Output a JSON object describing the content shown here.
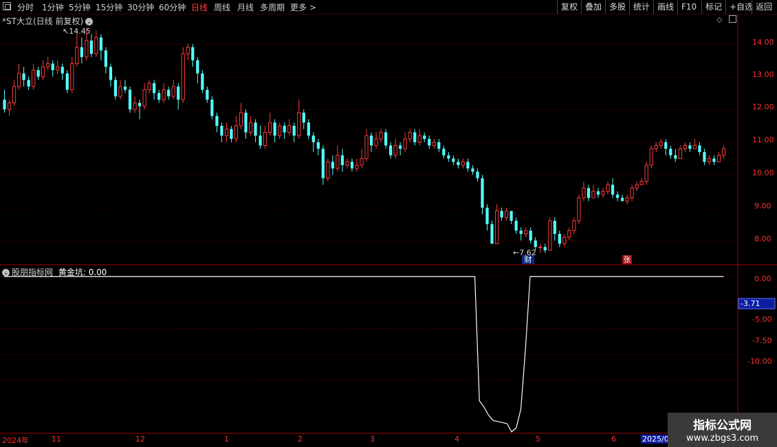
{
  "toolbar": {
    "periods": [
      "分时",
      "1分钟",
      "5分钟",
      "15分钟",
      "30分钟",
      "60分钟",
      "日线",
      "周线",
      "月线",
      "多周期",
      "更多"
    ],
    "active_period": "日线",
    "more_arrow": ">",
    "buttons": [
      "复权",
      "叠加",
      "多股",
      "统计",
      "画线",
      "F10",
      "标记",
      "+自选",
      "返回"
    ]
  },
  "main_chart": {
    "title": "*ST大立(日线 前复权)",
    "high_label": "14.45",
    "low_label": "7.62",
    "badge_cai": "财",
    "badge_zhang": "张",
    "price_axis": [
      "14.00",
      "13.00",
      "12.00",
      "11.00",
      "10.00",
      "9.00",
      "8.00"
    ]
  },
  "indicator": {
    "name": "股朋指标网",
    "series_name": "黄金坑:",
    "series_value": "0.00",
    "axis": [
      "0.00",
      "-2.50",
      "-5.00",
      "-7.50",
      "-10.00"
    ],
    "current_value": "-3.71"
  },
  "date_axis": [
    "2024年",
    "11",
    "12",
    "1",
    "2",
    "3",
    "4",
    "5",
    "6",
    "2025/0"
  ],
  "watermark": {
    "line1": "指标公式网",
    "line2": "www.zbgs3.com"
  },
  "colors": {
    "up": "#ff3c3c",
    "down": "#54ffff",
    "grid": "#7a0000",
    "axis": "#ff3030",
    "line": "#ffffff"
  },
  "chart_data": {
    "type": "candlestick",
    "price_ylim": [
      7.3,
      14.9
    ],
    "indicator_ylim": [
      -15,
      1
    ],
    "candles": [
      [
        12.3,
        12.0,
        12.6,
        11.9
      ],
      [
        12.0,
        12.2,
        12.3,
        11.8
      ],
      [
        12.2,
        12.7,
        12.9,
        12.1
      ],
      [
        12.7,
        13.1,
        13.4,
        12.6
      ],
      [
        13.1,
        12.9,
        13.3,
        12.7
      ],
      [
        12.9,
        12.7,
        13.0,
        12.6
      ],
      [
        12.7,
        13.2,
        13.4,
        12.6
      ],
      [
        13.2,
        13.0,
        13.3,
        12.9
      ],
      [
        13.0,
        13.3,
        13.5,
        12.9
      ],
      [
        13.3,
        13.4,
        13.6,
        13.2
      ],
      [
        13.4,
        13.2,
        13.5,
        13.0
      ],
      [
        13.2,
        13.3,
        13.5,
        13.1
      ],
      [
        13.3,
        13.1,
        13.4,
        12.9
      ],
      [
        13.1,
        12.6,
        13.2,
        12.5
      ],
      [
        12.6,
        13.4,
        13.6,
        12.5
      ],
      [
        13.4,
        13.9,
        14.3,
        13.3
      ],
      [
        13.9,
        13.6,
        14.2,
        13.4
      ],
      [
        13.6,
        14.1,
        14.45,
        13.5
      ],
      [
        14.1,
        13.7,
        14.3,
        13.6
      ],
      [
        13.7,
        14.2,
        14.4,
        13.6
      ],
      [
        14.2,
        13.8,
        14.3,
        13.5
      ],
      [
        13.8,
        13.3,
        13.9,
        13.1
      ],
      [
        13.3,
        12.9,
        13.4,
        12.7
      ],
      [
        12.9,
        12.4,
        13.0,
        12.3
      ],
      [
        12.4,
        12.7,
        12.9,
        12.3
      ],
      [
        12.7,
        12.6,
        12.9,
        12.5
      ],
      [
        12.6,
        12.0,
        12.7,
        11.9
      ],
      [
        12.0,
        12.2,
        12.4,
        11.9
      ],
      [
        12.2,
        12.1,
        12.3,
        11.7
      ],
      [
        12.1,
        12.6,
        12.8,
        12.0
      ],
      [
        12.6,
        12.8,
        12.9,
        12.5
      ],
      [
        12.8,
        12.5,
        12.9,
        12.3
      ],
      [
        12.5,
        12.3,
        12.6,
        12.2
      ],
      [
        12.3,
        12.6,
        12.8,
        12.2
      ],
      [
        12.6,
        12.4,
        12.7,
        12.3
      ],
      [
        12.4,
        12.7,
        12.9,
        12.3
      ],
      [
        12.7,
        12.3,
        12.8,
        12.0
      ],
      [
        12.3,
        13.7,
        13.9,
        12.2
      ],
      [
        13.7,
        13.9,
        14.0,
        13.5
      ],
      [
        13.9,
        13.5,
        14.0,
        13.3
      ],
      [
        13.5,
        13.1,
        13.6,
        12.8
      ],
      [
        13.1,
        12.6,
        13.2,
        12.5
      ],
      [
        12.6,
        12.3,
        12.7,
        12.2
      ],
      [
        12.3,
        11.8,
        12.4,
        11.7
      ],
      [
        11.8,
        11.5,
        11.9,
        11.3
      ],
      [
        11.5,
        11.2,
        11.6,
        11.0
      ],
      [
        11.2,
        11.4,
        11.6,
        11.0
      ],
      [
        11.4,
        11.1,
        11.5,
        11.0
      ],
      [
        11.1,
        11.5,
        11.8,
        11.0
      ],
      [
        11.5,
        11.9,
        12.2,
        11.4
      ],
      [
        11.9,
        11.3,
        12.0,
        11.1
      ],
      [
        11.3,
        11.6,
        11.8,
        11.2
      ],
      [
        11.6,
        11.2,
        11.7,
        11.0
      ],
      [
        11.2,
        10.9,
        11.5,
        10.8
      ],
      [
        10.9,
        11.3,
        11.5,
        10.8
      ],
      [
        11.3,
        11.6,
        11.9,
        11.2
      ],
      [
        11.6,
        11.2,
        11.7,
        11.0
      ],
      [
        11.2,
        11.5,
        11.6,
        11.1
      ],
      [
        11.5,
        11.3,
        11.6,
        11.1
      ],
      [
        11.3,
        11.5,
        11.7,
        11.2
      ],
      [
        11.5,
        11.2,
        11.6,
        11.0
      ],
      [
        11.2,
        11.9,
        12.3,
        11.1
      ],
      [
        11.9,
        11.6,
        12.0,
        11.4
      ],
      [
        11.6,
        11.2,
        11.7,
        11.1
      ],
      [
        11.2,
        11.0,
        11.3,
        10.7
      ],
      [
        11.0,
        10.8,
        11.1,
        10.6
      ],
      [
        10.8,
        9.9,
        10.9,
        9.7
      ],
      [
        9.9,
        10.4,
        10.5,
        9.8
      ],
      [
        10.4,
        10.2,
        10.6,
        10.0
      ],
      [
        10.2,
        10.6,
        10.9,
        10.1
      ],
      [
        10.6,
        10.3,
        10.8,
        10.1
      ],
      [
        10.3,
        10.4,
        10.5,
        10.2
      ],
      [
        10.4,
        10.2,
        10.5,
        10.1
      ],
      [
        10.2,
        10.3,
        10.5,
        10.1
      ],
      [
        10.3,
        10.5,
        10.8,
        10.2
      ],
      [
        10.5,
        11.2,
        11.4,
        10.4
      ],
      [
        11.2,
        10.9,
        11.3,
        10.7
      ],
      [
        10.9,
        11.1,
        11.3,
        10.8
      ],
      [
        11.1,
        11.3,
        11.4,
        11.0
      ],
      [
        11.3,
        10.9,
        11.4,
        10.8
      ],
      [
        10.9,
        10.6,
        11.0,
        10.5
      ],
      [
        10.6,
        10.9,
        11.1,
        10.5
      ],
      [
        10.9,
        10.8,
        11.0,
        10.6
      ],
      [
        10.8,
        11.1,
        11.3,
        10.7
      ],
      [
        11.1,
        11.3,
        11.4,
        11.0
      ],
      [
        11.3,
        11.0,
        11.4,
        10.9
      ],
      [
        11.0,
        11.2,
        11.4,
        10.9
      ],
      [
        11.2,
        11.1,
        11.3,
        11.0
      ],
      [
        11.1,
        10.9,
        11.2,
        10.8
      ],
      [
        10.9,
        11.0,
        11.1,
        10.8
      ],
      [
        11.0,
        10.8,
        11.1,
        10.7
      ],
      [
        10.8,
        10.6,
        10.9,
        10.5
      ],
      [
        10.6,
        10.5,
        10.7,
        10.4
      ],
      [
        10.5,
        10.4,
        10.6,
        10.3
      ],
      [
        10.4,
        10.3,
        10.5,
        10.2
      ],
      [
        10.3,
        10.4,
        10.5,
        10.2
      ],
      [
        10.4,
        10.2,
        10.5,
        10.1
      ],
      [
        10.2,
        10.1,
        10.3,
        10.0
      ],
      [
        10.1,
        9.9,
        10.2,
        9.8
      ],
      [
        9.9,
        9.0,
        10.0,
        8.8
      ],
      [
        9.0,
        8.5,
        9.1,
        8.3
      ],
      [
        8.5,
        7.9,
        8.6,
        7.9
      ],
      [
        7.9,
        8.9,
        9.1,
        7.9
      ],
      [
        8.9,
        8.7,
        9.0,
        8.6
      ],
      [
        8.7,
        8.9,
        9.0,
        8.6
      ],
      [
        8.9,
        8.6,
        8.9,
        8.5
      ],
      [
        8.6,
        8.3,
        8.7,
        8.2
      ],
      [
        8.3,
        8.2,
        8.4,
        8.0
      ],
      [
        8.2,
        8.3,
        8.4,
        8.1
      ],
      [
        8.3,
        8.0,
        8.4,
        7.9
      ],
      [
        8.0,
        7.8,
        8.1,
        7.7
      ],
      [
        7.8,
        7.8,
        7.9,
        7.62
      ],
      [
        7.8,
        7.7,
        7.9,
        7.62
      ],
      [
        7.7,
        8.6,
        8.7,
        7.7
      ],
      [
        8.6,
        8.2,
        8.7,
        8.0
      ],
      [
        8.2,
        7.9,
        8.3,
        7.8
      ],
      [
        7.9,
        8.1,
        8.2,
        7.8
      ],
      [
        8.1,
        8.3,
        8.4,
        8.0
      ],
      [
        8.3,
        8.6,
        8.7,
        8.2
      ],
      [
        8.6,
        9.3,
        9.4,
        8.5
      ],
      [
        9.3,
        9.6,
        9.8,
        9.2
      ],
      [
        9.6,
        9.3,
        9.7,
        9.2
      ],
      [
        9.3,
        9.5,
        9.7,
        9.3
      ],
      [
        9.5,
        9.4,
        9.6,
        9.3
      ],
      [
        9.4,
        9.5,
        9.6,
        9.3
      ],
      [
        9.5,
        9.7,
        9.8,
        9.4
      ],
      [
        9.7,
        9.4,
        9.9,
        9.3
      ],
      [
        9.4,
        9.3,
        9.5,
        9.2
      ],
      [
        9.3,
        9.2,
        9.4,
        9.2
      ],
      [
        9.2,
        9.3,
        9.4,
        9.1
      ],
      [
        9.3,
        9.6,
        9.7,
        9.2
      ],
      [
        9.6,
        9.7,
        9.8,
        9.5
      ],
      [
        9.7,
        9.8,
        9.9,
        9.7
      ],
      [
        9.8,
        10.3,
        10.4,
        9.7
      ],
      [
        10.3,
        10.8,
        10.9,
        10.2
      ],
      [
        10.8,
        10.9,
        11.0,
        10.7
      ],
      [
        10.9,
        11.0,
        11.1,
        10.8
      ],
      [
        11.0,
        10.8,
        11.1,
        10.6
      ],
      [
        10.8,
        10.6,
        10.9,
        10.5
      ],
      [
        10.6,
        10.5,
        10.8,
        10.4
      ],
      [
        10.5,
        10.8,
        10.9,
        10.5
      ],
      [
        10.8,
        10.9,
        11.0,
        10.7
      ],
      [
        10.9,
        10.8,
        11.0,
        10.7
      ],
      [
        10.8,
        10.9,
        11.1,
        10.8
      ],
      [
        10.9,
        10.7,
        11.0,
        10.6
      ],
      [
        10.7,
        10.4,
        10.8,
        10.3
      ],
      [
        10.4,
        10.5,
        10.6,
        10.3
      ],
      [
        10.5,
        10.4,
        10.6,
        10.3
      ],
      [
        10.4,
        10.6,
        10.7,
        10.4
      ],
      [
        10.6,
        10.8,
        10.9,
        10.5
      ]
    ],
    "indicator_values": [
      0,
      0,
      0,
      0,
      0,
      0,
      0,
      0,
      0,
      0,
      0,
      0,
      0,
      0,
      0,
      0,
      0,
      0,
      0,
      0,
      0,
      0,
      0,
      0,
      0,
      0,
      0,
      0,
      0,
      0,
      0,
      0,
      0,
      0,
      0,
      0,
      0,
      0,
      0,
      0,
      0,
      0,
      0,
      0,
      0,
      0,
      0,
      0,
      0,
      0,
      0,
      0,
      0,
      0,
      0,
      0,
      0,
      0,
      0,
      0,
      0,
      0,
      0,
      0,
      0,
      0,
      0,
      0,
      0,
      0,
      0,
      0,
      0,
      0,
      0,
      0,
      0,
      0,
      0,
      0,
      0,
      0,
      0,
      0,
      0,
      0,
      0,
      0,
      0,
      0,
      0,
      0,
      0,
      0,
      0,
      0,
      0,
      0,
      0,
      0,
      0,
      0,
      0,
      -12.0,
      -12.6,
      -13.4,
      -13.9,
      -14.0,
      -14.1,
      -14.2,
      -15.0,
      -14.6,
      -12.8,
      -7.0,
      0,
      0,
      0,
      0,
      0,
      0,
      0,
      0,
      0,
      0,
      0,
      0,
      0,
      0,
      0,
      0,
      0,
      0,
      0,
      0,
      0,
      0,
      0,
      0,
      0,
      0,
      0,
      0,
      0,
      0,
      0,
      0,
      0,
      0,
      0,
      0,
      0,
      0,
      0,
      0,
      0,
      0,
      0
    ]
  }
}
